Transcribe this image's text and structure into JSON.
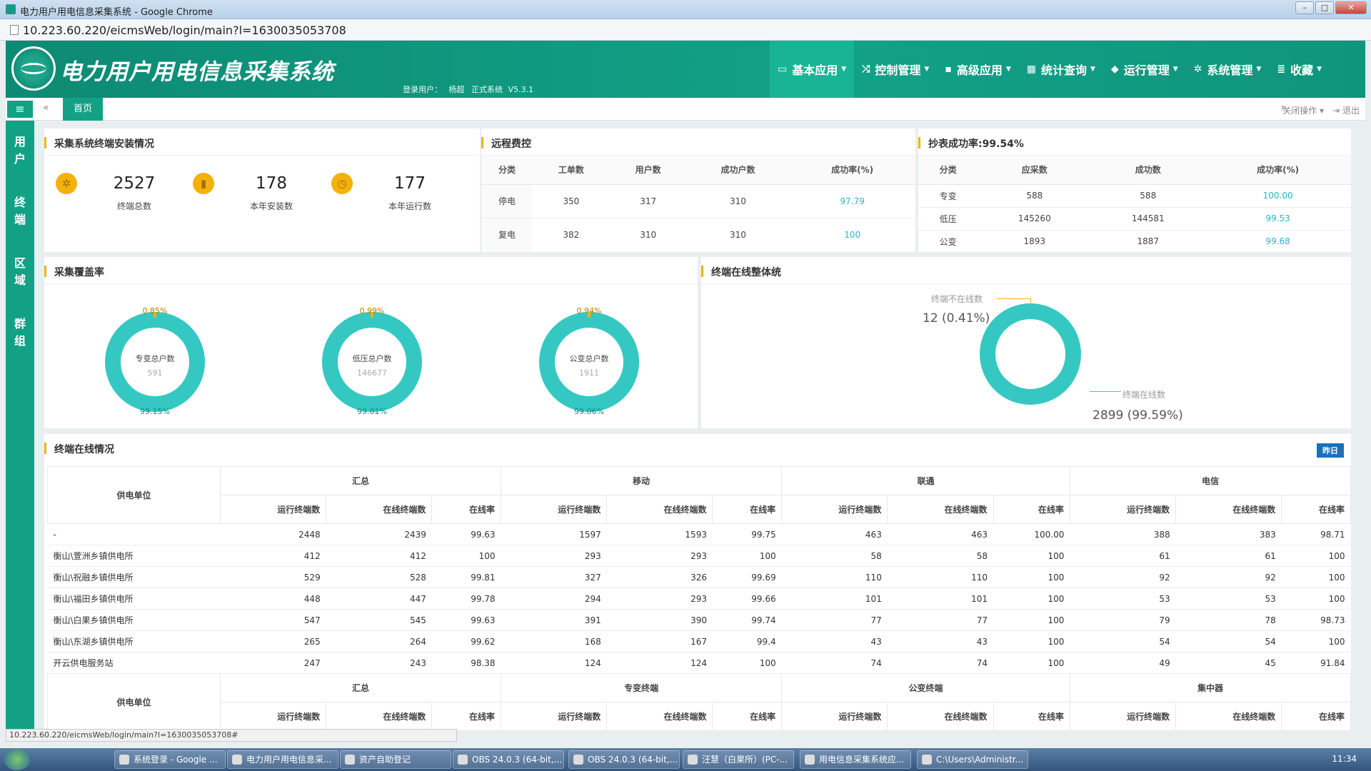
{
  "browser": {
    "title": "电力用户用电信息采集系统 - Google Chrome",
    "url": "10.223.60.220/eicmsWeb/login/main?l=1630035053708"
  },
  "header": {
    "title": "电力用户用电信息采集系统",
    "login_label": "登录用户：",
    "user": "杨超",
    "system": "正式系统",
    "version": "V5.3.1",
    "nav": [
      {
        "label": "基本应用",
        "icon": "monitor-icon"
      },
      {
        "label": "控制管理",
        "icon": "shuffle-icon"
      },
      {
        "label": "高级应用",
        "icon": "save-icon"
      },
      {
        "label": "统计查询",
        "icon": "grid-icon"
      },
      {
        "label": "运行管理",
        "icon": "tag-icon"
      },
      {
        "label": "系统管理",
        "icon": "gear-icon"
      },
      {
        "label": "收藏",
        "icon": "list-icon"
      }
    ]
  },
  "tabbar": {
    "home": "首页",
    "close_ops": "关闭操作",
    "logout": "退出"
  },
  "sidebar": [
    [
      "用",
      "户"
    ],
    [
      "终",
      "端"
    ],
    [
      "区",
      "域"
    ],
    [
      "群",
      "组"
    ]
  ],
  "install": {
    "title": "采集系统终端安装情况",
    "stats": [
      {
        "value": "2527",
        "label": "终端总数"
      },
      {
        "value": "178",
        "label": "本年安装数"
      },
      {
        "value": "177",
        "label": "本年运行数"
      }
    ]
  },
  "remote": {
    "title": "远程费控",
    "headers": [
      "分类",
      "工单数",
      "用户数",
      "成功户数",
      "成功率(%)"
    ],
    "rows": [
      [
        "停电",
        "350",
        "317",
        "310",
        "97.79"
      ],
      [
        "复电",
        "382",
        "310",
        "310",
        "100"
      ]
    ]
  },
  "meter": {
    "title": "抄表成功率:99.54%",
    "headers": [
      "分类",
      "应采数",
      "成功数",
      "成功率(%)"
    ],
    "rows": [
      [
        "专变",
        "588",
        "588",
        "100.00"
      ],
      [
        "低压",
        "145260",
        "144581",
        "99.53"
      ],
      [
        "公变",
        "1893",
        "1887",
        "99.68"
      ]
    ]
  },
  "coverage": {
    "title": "采集覆盖率",
    "donuts": [
      {
        "label": "专变总户数",
        "count": "591",
        "top": "0.85%",
        "bottom": "99.15%"
      },
      {
        "label": "低压总户数",
        "count": "146677",
        "top": "0.99%",
        "bottom": "99.01%"
      },
      {
        "label": "公变总户数",
        "count": "1911",
        "top": "0.94%",
        "bottom": "99.06%"
      }
    ]
  },
  "online_overall": {
    "title": "终端在线整体统",
    "offline_label": "终端不在线数",
    "offline_value": "12  (0.41%)",
    "online_label": "终端在线数",
    "online_value": "2899  (99.59%)"
  },
  "online": {
    "title": "终端在线情况",
    "yesterday": "昨日",
    "unit_header": "供电单位",
    "groups": [
      "汇总",
      "移动",
      "联通",
      "电信"
    ],
    "sub": [
      "运行终端数",
      "在线终端数",
      "在线率"
    ],
    "rows": [
      [
        "-",
        "2448",
        "2439",
        "99.63",
        "1597",
        "1593",
        "99.75",
        "463",
        "463",
        "100.00",
        "388",
        "383",
        "98.71"
      ],
      [
        "衡山\\萱洲乡镇供电所",
        "412",
        "412",
        "100",
        "293",
        "293",
        "100",
        "58",
        "58",
        "100",
        "61",
        "61",
        "100"
      ],
      [
        "衡山\\祝融乡镇供电所",
        "529",
        "528",
        "99.81",
        "327",
        "326",
        "99.69",
        "110",
        "110",
        "100",
        "92",
        "92",
        "100"
      ],
      [
        "衡山\\福田乡镇供电所",
        "448",
        "447",
        "99.78",
        "294",
        "293",
        "99.66",
        "101",
        "101",
        "100",
        "53",
        "53",
        "100"
      ],
      [
        "衡山\\白果乡镇供电所",
        "547",
        "545",
        "99.63",
        "391",
        "390",
        "99.74",
        "77",
        "77",
        "100",
        "79",
        "78",
        "98.73"
      ],
      [
        "衡山\\东湖乡镇供电所",
        "265",
        "264",
        "99.62",
        "168",
        "167",
        "99.4",
        "43",
        "43",
        "100",
        "54",
        "54",
        "100"
      ],
      [
        "开云供电服务站",
        "247",
        "243",
        "98.38",
        "124",
        "124",
        "100",
        "74",
        "74",
        "100",
        "49",
        "45",
        "91.84"
      ]
    ],
    "groups2": [
      "汇总",
      "专变终端",
      "公变终端",
      "集中器"
    ]
  },
  "status_url": "10.223.60.220/eicmsWeb/login/main?l=1630035053708#",
  "taskbar": {
    "items": [
      "系统登录 - Google ...",
      "电力用户用电信息采...",
      "资产自助登记",
      "OBS 24.0.3 (64-bit,...",
      "OBS 24.0.3 (64-bit,...",
      "汪慧（白果所）(PC-...",
      "用电信息采集系统应...",
      "C:\\Users\\Administr..."
    ],
    "time": "11:34"
  }
}
